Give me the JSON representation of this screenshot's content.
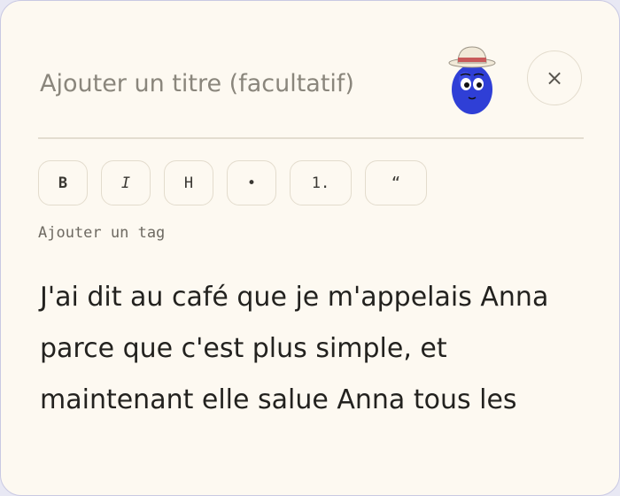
{
  "editor": {
    "title_placeholder": "Ajouter un titre (facultatif)",
    "close_label": "×",
    "add_tag_label": "Ajouter un tag",
    "body_text": "J'ai dit au café que je m'appelais Anna parce que c'est plus simple, et maintenant elle salue Anna tous les"
  },
  "toolbar": {
    "buttons": [
      {
        "label": "B",
        "name": "bold"
      },
      {
        "label": "I",
        "name": "italic"
      },
      {
        "label": "H",
        "name": "heading"
      },
      {
        "label": "•",
        "name": "bullet-list"
      },
      {
        "label": "1.",
        "name": "numbered-list"
      },
      {
        "label": "“",
        "name": "quote"
      }
    ]
  },
  "colors": {
    "card_background": "#fdf9f1",
    "mascot_body": "#2f3fd6",
    "mascot_hat_band": "#c85a5a"
  },
  "icons": {
    "mascot": "blue-blob-mascot-with-hat-icon",
    "close": "close-icon"
  }
}
